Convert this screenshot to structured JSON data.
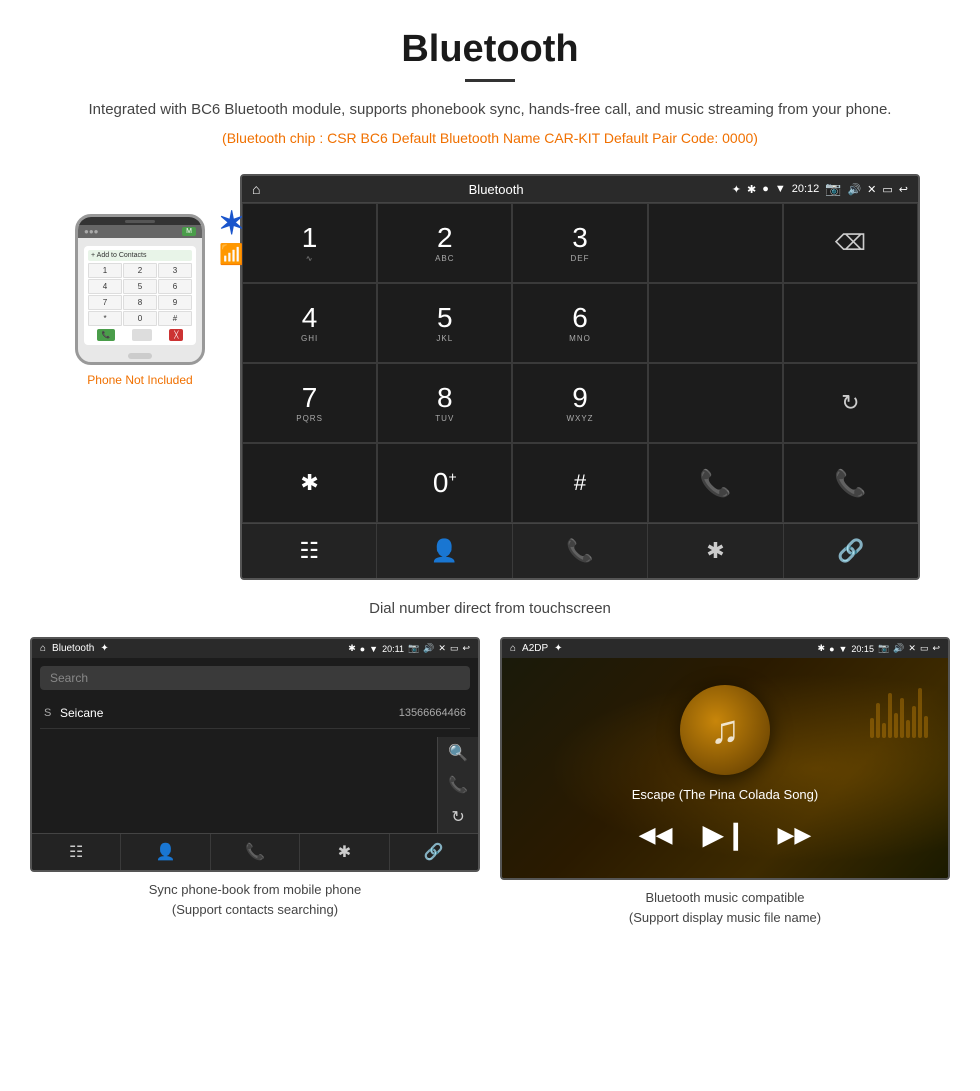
{
  "header": {
    "title": "Bluetooth",
    "description": "Integrated with BC6 Bluetooth module, supports phonebook sync, hands-free call, and music streaming from your phone.",
    "specs": "(Bluetooth chip : CSR BC6    Default Bluetooth Name CAR-KIT    Default Pair Code: 0000)"
  },
  "phone_label": "Phone Not Included",
  "main_screen": {
    "statusbar": {
      "app_name": "Bluetooth",
      "time": "20:12"
    },
    "dialer": {
      "keys": [
        {
          "num": "1",
          "sub": ""
        },
        {
          "num": "2",
          "sub": "ABC"
        },
        {
          "num": "3",
          "sub": "DEF"
        },
        {
          "num": "",
          "sub": ""
        },
        {
          "num": "",
          "sub": "backspace"
        },
        {
          "num": "4",
          "sub": "GHI"
        },
        {
          "num": "5",
          "sub": "JKL"
        },
        {
          "num": "6",
          "sub": "MNO"
        },
        {
          "num": "",
          "sub": ""
        },
        {
          "num": "",
          "sub": ""
        },
        {
          "num": "7",
          "sub": "PQRS"
        },
        {
          "num": "8",
          "sub": "TUV"
        },
        {
          "num": "9",
          "sub": "WXYZ"
        },
        {
          "num": "",
          "sub": ""
        },
        {
          "num": "",
          "sub": "redial"
        },
        {
          "num": "*",
          "sub": ""
        },
        {
          "num": "0",
          "sub": "+"
        },
        {
          "num": "#",
          "sub": ""
        },
        {
          "num": "",
          "sub": "call_green"
        },
        {
          "num": "",
          "sub": "call_red"
        }
      ]
    },
    "bottom_nav": [
      "grid",
      "person",
      "phone",
      "bluetooth",
      "link"
    ]
  },
  "screen_caption": "Dial number direct from touchscreen",
  "bottom_left": {
    "statusbar_app": "Bluetooth",
    "statusbar_time": "20:11",
    "search_placeholder": "Search",
    "contact_letter": "S",
    "contact_name": "Seicane",
    "contact_number": "13566664466",
    "caption_line1": "Sync phone-book from mobile phone",
    "caption_line2": "(Support contacts searching)"
  },
  "bottom_right": {
    "statusbar_app": "A2DP",
    "statusbar_time": "20:15",
    "song_title": "Escape (The Pina Colada Song)",
    "caption_line1": "Bluetooth music compatible",
    "caption_line2": "(Support display music file name)"
  },
  "icons": {
    "home": "⌂",
    "bluetooth_sym": "✱",
    "back": "↩",
    "grid": "⊞",
    "person": "👤",
    "phone": "📞",
    "bluetooth": "✱",
    "link": "🔗",
    "prev": "⏮",
    "play": "⏯",
    "next": "⏭",
    "music_note": "♪",
    "search": "🔍",
    "call_green": "📞",
    "call_red": "📵"
  }
}
